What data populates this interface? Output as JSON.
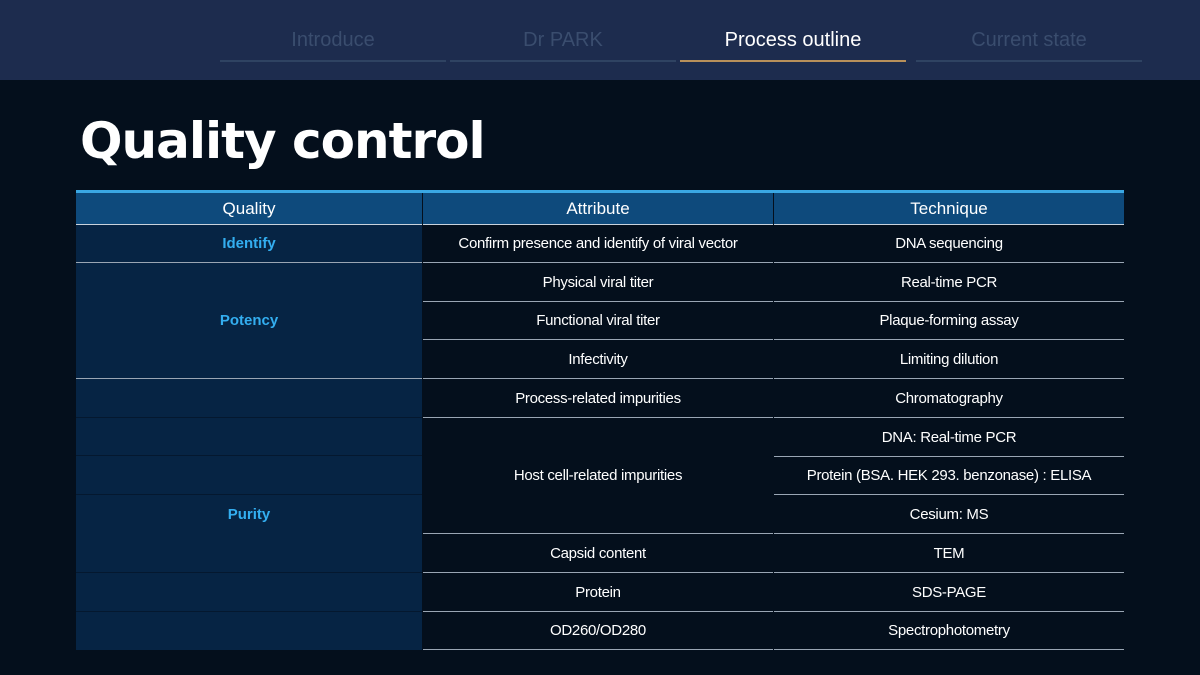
{
  "nav": {
    "tabs": [
      {
        "label": "Introduce",
        "active": false
      },
      {
        "label": "Dr PARK",
        "active": false
      },
      {
        "label": "Process outline",
        "active": true
      },
      {
        "label": "Current state",
        "active": false
      }
    ]
  },
  "page_title": "Quality control",
  "table": {
    "headers": [
      "Quality",
      "Attribute",
      "Technique"
    ],
    "qualities": [
      "Identify",
      "Potency",
      "Purity"
    ],
    "attributes": [
      "Confirm presence and identify of viral vector",
      "Physical viral titer",
      "Functional viral titer",
      "Infectivity",
      "Process-related impurities",
      "Host cell-related impurities",
      "Capsid content",
      "Protein",
      "OD260/OD280"
    ],
    "techniques": [
      "DNA sequencing",
      "Real-time PCR",
      "Plaque-forming assay",
      "Limiting dilution",
      "Chromatography",
      "DNA: Real-time PCR",
      "Protein (BSA. HEK 293. benzonase) : ELISA",
      "Cesium: MS",
      "TEM",
      "SDS-PAGE",
      "Spectrophotometry"
    ]
  },
  "colors": {
    "background": "#040f1c",
    "topbar": "#1d2c4e",
    "header_row": "#0e4a7c",
    "quality_cell": "#062444",
    "quality_text": "#33aef0",
    "active_tab_underline": "#b8905a",
    "table_top_border": "#3aa8e4"
  }
}
